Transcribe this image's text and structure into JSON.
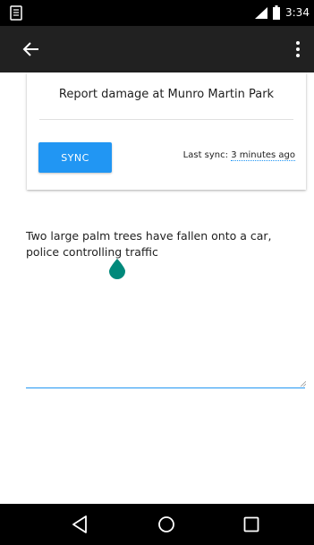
{
  "status_bar": {
    "time": "3:34",
    "icons": [
      "notification-icon",
      "signal-icon",
      "battery-icon"
    ]
  },
  "app_bar": {
    "icons": [
      "back-arrow-icon",
      "more-vert-icon"
    ]
  },
  "card": {
    "title": "Report damage at Munro Martin Park",
    "sync_label": "SYNC",
    "last_sync_label": "Last sync: ",
    "last_sync_value": "3 minutes ago"
  },
  "note": {
    "text": "Two large palm trees have fallen onto a car, police controlling traffic"
  },
  "nav_bar": {
    "icons": [
      "nav-back-icon",
      "nav-home-icon",
      "nav-recents-icon"
    ]
  },
  "colors": {
    "accent": "#2196f3",
    "app_bar": "#212121",
    "cursor_handle": "#00897b"
  }
}
